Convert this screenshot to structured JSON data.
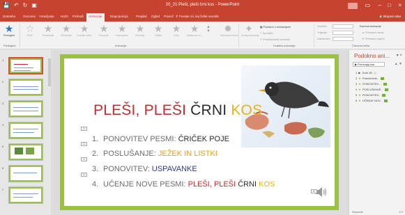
{
  "app": {
    "title": "20_21 Pleši, pleši črni kos - PowerPoint",
    "signin_label": "Prijava",
    "share_label": "Skupna raba",
    "window_controls": [
      "restore-icon",
      "minimize-icon",
      "maximize-icon",
      "close-icon"
    ],
    "quick_access": [
      "save-icon",
      "undo-icon",
      "redo-icon",
      "present-icon"
    ]
  },
  "tabs": [
    {
      "label": "Datoteka",
      "active": false
    },
    {
      "label": "Osnovno",
      "active": false
    },
    {
      "label": "Vstavljanje",
      "active": false
    },
    {
      "label": "Načrt",
      "active": false
    },
    {
      "label": "Prehodi",
      "active": false
    },
    {
      "label": "Animacije",
      "active": true
    },
    {
      "label": "Diaprojekcija",
      "active": false
    },
    {
      "label": "Pregled",
      "active": false
    },
    {
      "label": "Ogled",
      "active": false
    },
    {
      "label": "Pomoč",
      "active": false
    }
  ],
  "tell_me": "Povejte mi, kaj želite narediti",
  "ribbon": {
    "preview_label": "Predogled",
    "preview_group": "Predogled",
    "animation_group": "Animacija",
    "advanced_group": "Dodatna animacija",
    "timing_group": "Časovna izbira",
    "animations": [
      "Brez",
      "Prikazanje",
      "Zbledenje",
      "Letenje noter",
      "Plavanje",
      "Razcepitev",
      "Brisanje",
      "Oblika",
      "Kolo",
      "Naključne vr..."
    ],
    "effect_options": "Možnosti učinka",
    "add_animation": "Dodaj animacijo",
    "animation_pane": "Podokno z animacijami",
    "trigger": "Sprožilec",
    "painter": "Preslikovalnik animacij",
    "start": "Začetek:",
    "duration": "Trajanje:",
    "delay": "Zakasnitev:",
    "reorder": "Razvrsti animacije",
    "move_earlier": "Premakni nazaj",
    "move_later": "Premakni naprej"
  },
  "thumbnails": [
    {
      "num": "1",
      "selected": true
    },
    {
      "num": "2",
      "selected": false
    },
    {
      "num": "3",
      "selected": false
    },
    {
      "num": "4",
      "selected": false
    },
    {
      "num": "5",
      "selected": false
    },
    {
      "num": "6",
      "selected": false
    },
    {
      "num": "7",
      "selected": false
    }
  ],
  "slide": {
    "title_parts": [
      {
        "text": "PLEŠI, PLEŠI ",
        "color": "#c12d2d"
      },
      {
        "text": "ČRNI ",
        "color": "#2a2a2a"
      },
      {
        "text": "KOS",
        "color": "#e8b21a"
      }
    ],
    "items": [
      {
        "num": "1.",
        "parts": [
          {
            "text": "PONOVITEV PESMI: ",
            "color": "#6c6c6c"
          },
          {
            "text": "ČRIČEK POJE",
            "color": "#2a2a2a"
          }
        ]
      },
      {
        "num": "2.",
        "parts": [
          {
            "text": "POSLUŠANJE: ",
            "color": "#6c6c6c"
          },
          {
            "text": "JEŽEK IN LISTKI",
            "color": "#e8a012"
          }
        ]
      },
      {
        "num": "3.",
        "parts": [
          {
            "text": "PONOVITEV: ",
            "color": "#6c6c6c"
          },
          {
            "text": "USPAVANKE",
            "color": "#2d3a8c"
          }
        ]
      },
      {
        "num": "4.",
        "parts": [
          {
            "text": "UČENJE NOVE PESMI: ",
            "color": "#6c6c6c"
          },
          {
            "text": "PLEŠI, PLEŠI ",
            "color": "#c12d2d"
          },
          {
            "text": "ČRNI ",
            "color": "#2a2a2a"
          },
          {
            "text": "KOS",
            "color": "#e8b21a"
          }
        ]
      }
    ],
    "markers": [
      "1",
      "2",
      "3",
      "4",
      "5",
      "6"
    ]
  },
  "pane": {
    "title": "Podokno ani...",
    "play_label": "Predvajaj vse",
    "items": [
      {
        "num": "1",
        "label": "Zvok 38"
      },
      {
        "num": "2",
        "label": "Pravokotnik..."
      },
      {
        "num": "3",
        "label": "PONOVITEV ..."
      },
      {
        "num": "4",
        "label": "POSLUŠANJE..."
      },
      {
        "num": "5",
        "label": "PONOVITEV..."
      },
      {
        "num": "6",
        "label": "UČENJE NOV..."
      }
    ],
    "footer_label": "Sekunde",
    "footer_range": "0   2"
  }
}
